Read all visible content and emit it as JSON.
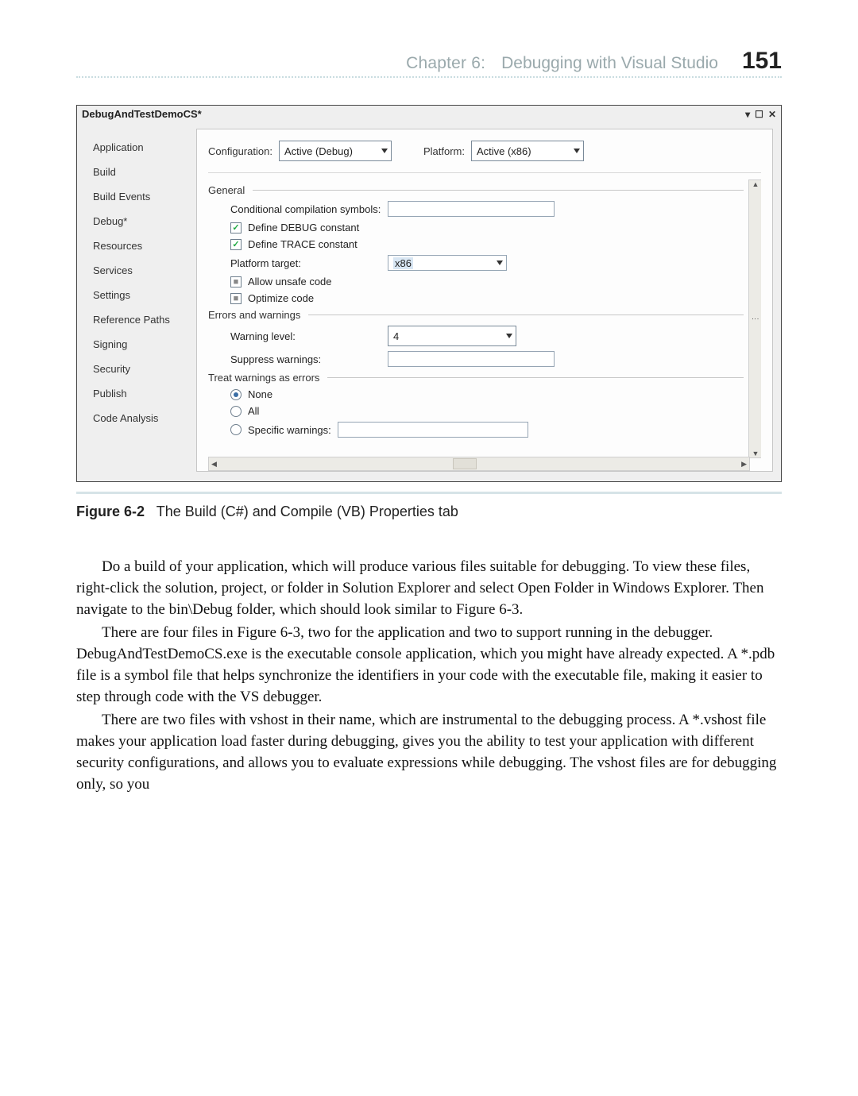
{
  "header": {
    "chapter": "Chapter 6:",
    "title": "Debugging with Visual Studio",
    "page_number": "151"
  },
  "figure": {
    "window_title": "DebugAndTestDemoCS*",
    "chrome": {
      "dropdown": "▾",
      "maximize": "☐",
      "close": "✕"
    },
    "sidebar": {
      "items": [
        "Application",
        "Build",
        "Build Events",
        "Debug*",
        "Resources",
        "Services",
        "Settings",
        "Reference Paths",
        "Signing",
        "Security",
        "Publish",
        "Code Analysis"
      ]
    },
    "config_row": {
      "config_label": "Configuration:",
      "config_value": "Active (Debug)",
      "platform_label": "Platform:",
      "platform_value": "Active (x86)"
    },
    "section_general": {
      "title": "General",
      "cond_symbols_label": "Conditional compilation symbols:",
      "define_debug": "Define DEBUG constant",
      "define_trace": "Define TRACE constant",
      "platform_target_label": "Platform target:",
      "platform_target_value": "x86",
      "allow_unsafe": "Allow unsafe code",
      "optimize": "Optimize code"
    },
    "section_errors": {
      "title": "Errors and warnings",
      "warning_level_label": "Warning level:",
      "warning_level_value": "4",
      "suppress_label": "Suppress warnings:"
    },
    "section_treat": {
      "title": "Treat warnings as errors",
      "none": "None",
      "all": "All",
      "specific": "Specific warnings:"
    },
    "scroll": {
      "up": "▲",
      "down": "▼",
      "left": "◀",
      "right": "▶",
      "grip": "⋯"
    }
  },
  "caption": {
    "label": "Figure 6-2",
    "text": "The Build (C#) and Compile (VB) Properties tab"
  },
  "body": {
    "p1": "Do a build of your application, which will produce various files suitable for debugging. To view these files, right-click the solution, project, or folder in Solution Explorer and select Open Folder in Windows Explorer. Then navigate to the bin\\Debug folder, which should look similar to Figure 6-3.",
    "p2": "There are four files in Figure 6-3, two for the application and two to support running in the debugger. DebugAndTestDemoCS.exe is the executable console application, which you might have already expected. A *.pdb file is a symbol file that helps synchronize the identifiers in your code with the executable file, making it easier to step through code with the VS debugger.",
    "p3": "There are two files with vshost in their name, which are instrumental to the debugging process. A *.vshost file makes your application load faster during debugging, gives you the ability to test your application with different security configurations, and allows you to evaluate expressions while debugging. The vshost files are for debugging only, so you"
  }
}
